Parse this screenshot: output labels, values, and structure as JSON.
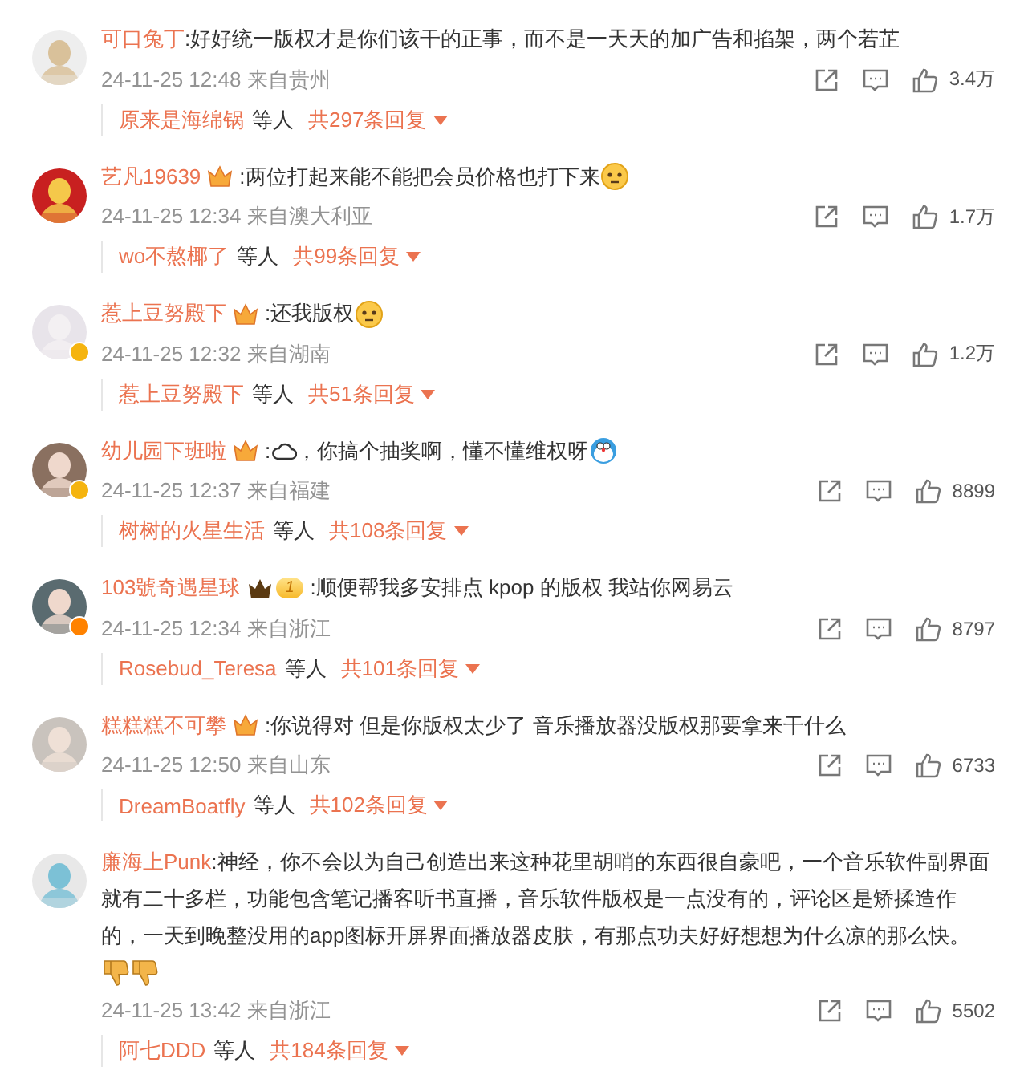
{
  "comments": [
    {
      "user": "可口兔丁",
      "parts": [
        {
          "kind": "text",
          "text": ":好好统一版权才是你们该干的正事，而不是一天天的加广告和掐架，两个若芷"
        }
      ],
      "time": "24-11-25 12:48",
      "location": "来自贵州",
      "likes": "3.4万",
      "reply_user": "原来是海绵锅",
      "reply_suffix": "等人",
      "reply_count": "共297条回复"
    },
    {
      "user": "艺凡19639",
      "badge": {
        "kind": "crown"
      },
      "parts": [
        {
          "kind": "text",
          "text": ":两位打起来能不能把会员价格也打下来"
        },
        {
          "kind": "face"
        }
      ],
      "time": "24-11-25 12:34",
      "location": "来自澳大利亚",
      "likes": "1.7万",
      "reply_user": "wo不熬椰了",
      "reply_suffix": "等人",
      "reply_count": "共99条回复"
    },
    {
      "user": "惹上豆努殿下",
      "badge": {
        "kind": "crown"
      },
      "verified": {
        "color": "#f5b40f"
      },
      "parts": [
        {
          "kind": "text",
          "text": ":还我版权"
        },
        {
          "kind": "face"
        }
      ],
      "time": "24-11-25 12:32",
      "location": "来自湖南",
      "likes": "1.2万",
      "reply_user": "惹上豆努殿下",
      "reply_suffix": "等人",
      "reply_count": "共51条回复"
    },
    {
      "user": "幼儿园下班啦",
      "badge": {
        "kind": "crown"
      },
      "verified": {
        "color": "#f5b40f"
      },
      "parts": [
        {
          "kind": "text",
          "text": ":"
        },
        {
          "kind": "cloud"
        },
        {
          "kind": "text",
          "text": "，你搞个抽奖啊，懂不懂维权呀"
        },
        {
          "kind": "blue-face"
        }
      ],
      "time": "24-11-25 12:37",
      "location": "来自福建",
      "likes": "8899",
      "reply_user": "树树的火星生活",
      "reply_suffix": "等人",
      "reply_count": "共108条回复"
    },
    {
      "user": "103號奇遇星球",
      "badge": {
        "kind": "level",
        "text": "1"
      },
      "verified": {
        "color": "#ff8200"
      },
      "parts": [
        {
          "kind": "text",
          "text": ":顺便帮我多安排点 kpop 的版权 我站你网易云"
        }
      ],
      "time": "24-11-25 12:34",
      "location": "来自浙江",
      "likes": "8797",
      "reply_user": "Rosebud_Teresa",
      "reply_suffix": "等人",
      "reply_count": "共101条回复"
    },
    {
      "user": "糕糕糕不可攀",
      "badge": {
        "kind": "crown"
      },
      "parts": [
        {
          "kind": "text",
          "text": ":你说得对  但是你版权太少了  音乐播放器没版权那要拿来干什么"
        }
      ],
      "time": "24-11-25 12:50",
      "location": "来自山东",
      "likes": "6733",
      "reply_user": "DreamBoatfly",
      "reply_suffix": "等人",
      "reply_count": "共102条回复"
    },
    {
      "user": "廉海上Punk",
      "parts": [
        {
          "kind": "text",
          "text": ":神经，你不会以为自己创造出来这种花里胡哨的东西很自豪吧，一个音乐软件副界面就有二十多栏，功能包含笔记播客听书直播，音乐软件版权是一点没有的，评论区是矫揉造作的，一天到晚整没用的app图标开屏界面播放器皮肤，有那点功夫好好想想为什么凉的那么快。"
        },
        {
          "kind": "break"
        },
        {
          "kind": "thumbs-down"
        },
        {
          "kind": "thumbs-down"
        }
      ],
      "time": "24-11-25 13:42",
      "location": "来自浙江",
      "likes": "5502",
      "reply_user": "阿七DDD",
      "reply_suffix": "等人",
      "reply_count": "共184条回复"
    }
  ]
}
